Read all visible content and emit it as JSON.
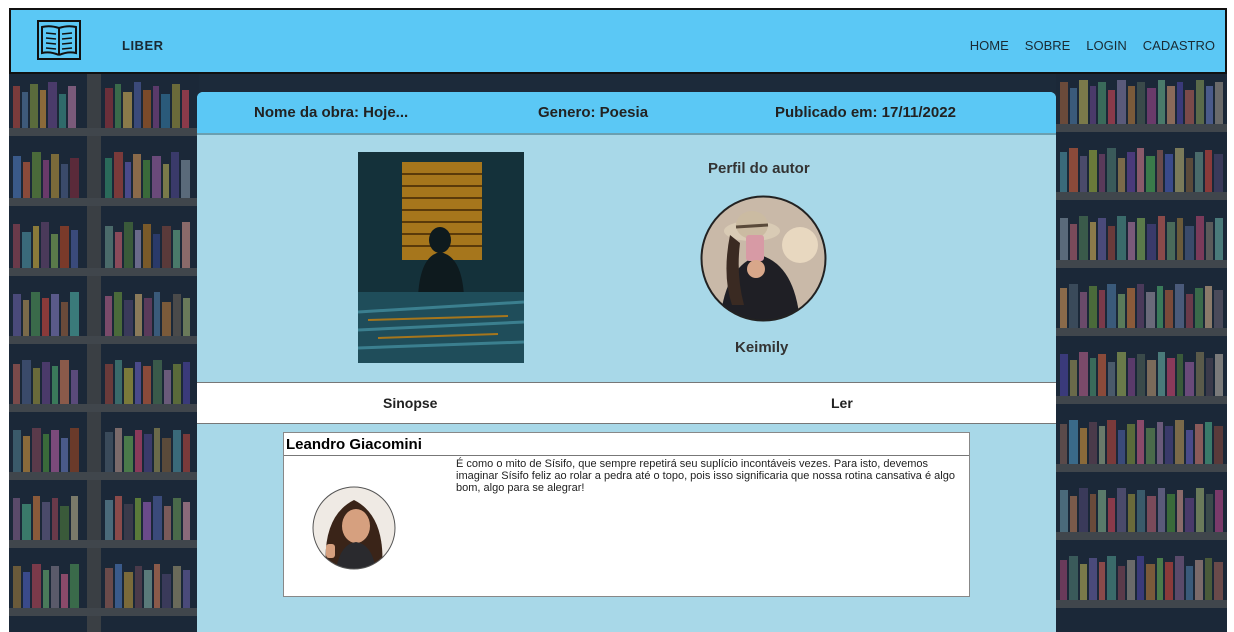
{
  "header": {
    "brand": "LIBER",
    "nav": [
      "HOME",
      "SOBRE",
      "LOGIN",
      "CADASTRO"
    ]
  },
  "work": {
    "title_label": "Nome da obra: Hoje...",
    "genre_label": "Genero: Poesia",
    "published_label": "Publicado em: 17/11/2022"
  },
  "author": {
    "section_title": "Perfil do autor",
    "name": "Keimily"
  },
  "tabs": {
    "synopsis": "Sinopse",
    "read": "Ler"
  },
  "comment": {
    "author": "Leandro Giacomini",
    "text": "É como o mito de Sísifo, que sempre repetirá seu suplício incontáveis vezes. Para isto, devemos imaginar Sísifo feliz ao rolar a pedra até o topo, pois isso significaria que nossa rotina cansativa é algo bom, algo para se alegrar!"
  },
  "colors": {
    "header_bg": "#5bc8f5",
    "card_bg": "#a8d8e8",
    "tab_bg": "#ffffff"
  },
  "icons": {
    "logo": "open-book-icon"
  }
}
